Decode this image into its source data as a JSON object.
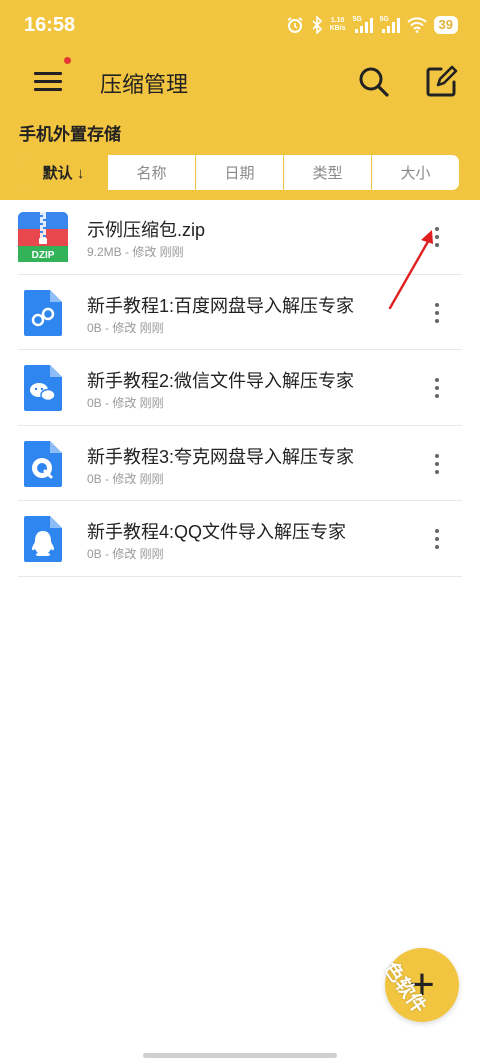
{
  "status_bar": {
    "time": "16:58",
    "net_speed_value": "1.10",
    "net_speed_unit": "KB/s",
    "signal1_label": "5G",
    "signal2_label": "5G",
    "battery": "39"
  },
  "app_bar": {
    "title": "压缩管理",
    "menu_icon": "hamburger-menu-icon",
    "search_icon": "search-icon",
    "edit_icon": "edit-icon"
  },
  "storage_label": "手机外置存储",
  "sort_tabs": [
    {
      "label": "默认 ↓",
      "active": true
    },
    {
      "label": "名称",
      "active": false
    },
    {
      "label": "日期",
      "active": false
    },
    {
      "label": "类型",
      "active": false
    },
    {
      "label": "大小",
      "active": false
    }
  ],
  "files": [
    {
      "name": "示例压缩包.zip",
      "meta": "9.2MB - 修改 刚刚",
      "icon": "zip-archive-icon",
      "icon_label": "DZIP"
    },
    {
      "name": "新手教程1:百度网盘导入解压专家",
      "meta": "0B - 修改 刚刚",
      "icon": "baidu-netdisk-doc-icon"
    },
    {
      "name": "新手教程2:微信文件导入解压专家",
      "meta": "0B - 修改 刚刚",
      "icon": "wechat-doc-icon"
    },
    {
      "name": "新手教程3:夸克网盘导入解压专家",
      "meta": "0B - 修改 刚刚",
      "icon": "quark-doc-icon"
    },
    {
      "name": "新手教程4:QQ文件导入解压专家",
      "meta": "0B - 修改 刚刚",
      "icon": "qq-doc-icon"
    }
  ],
  "fab_label": "+",
  "watermark": "色软件",
  "colors": {
    "accent": "#f2c541",
    "doc_blue": "#2f86f0",
    "arrow_red": "#e02020"
  }
}
